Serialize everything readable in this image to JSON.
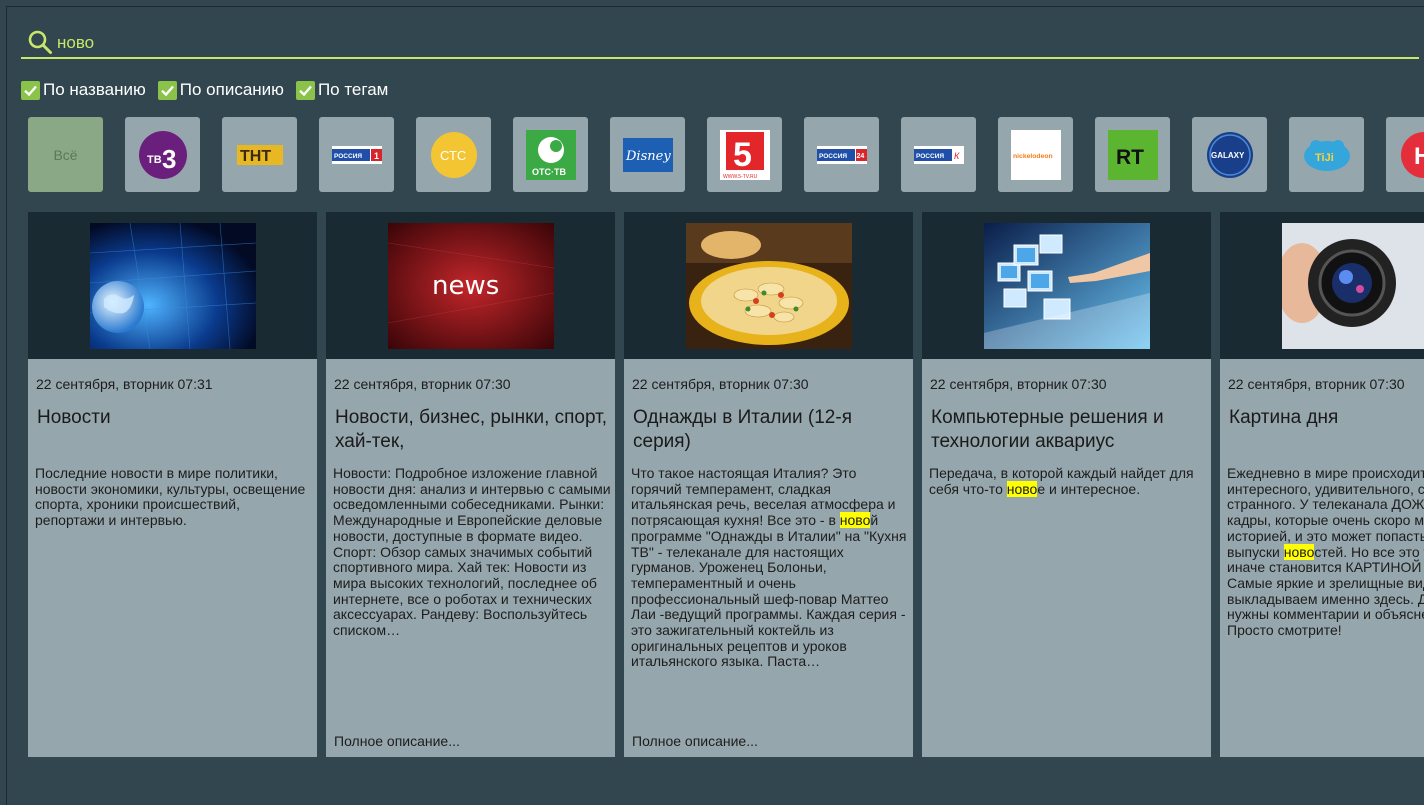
{
  "search": {
    "value": "ново",
    "accent": "#c8e76a"
  },
  "filters": [
    {
      "label": "По названию",
      "checked": true
    },
    {
      "label": "По описанию",
      "checked": true
    },
    {
      "label": "По тегам",
      "checked": true
    }
  ],
  "channels": {
    "all_label": "Всё",
    "items": [
      {
        "name": "тв3-logo",
        "text": "ТВ3"
      },
      {
        "name": "tnt-logo",
        "text": "ТНТ"
      },
      {
        "name": "russia1-logo",
        "text": "РОССИЯ 1"
      },
      {
        "name": "sts-logo",
        "text": "СТС"
      },
      {
        "name": "otstv-logo",
        "text": "ОТС-ТВ"
      },
      {
        "name": "disney-logo",
        "text": "Disney"
      },
      {
        "name": "channel5-logo",
        "text": "5"
      },
      {
        "name": "russia24-logo",
        "text": "РОССИЯ 24"
      },
      {
        "name": "russiak-logo",
        "text": "РОССИЯ К"
      },
      {
        "name": "nickelodeon-logo",
        "text": "nickelodeon"
      },
      {
        "name": "rt-logo",
        "text": "RT"
      },
      {
        "name": "galaxy-logo",
        "text": "GALAXY"
      },
      {
        "name": "tiji-logo",
        "text": "TiJi"
      },
      {
        "name": "partial-logo",
        "text": "Н"
      }
    ]
  },
  "cards": [
    {
      "date": "22 сентября, вторник 07:31",
      "title": "Новости",
      "desc": [
        "Последние новости в мире политики, новости экономики, культуры, освещение спорта, хроники происшествий, репортажи и интервью."
      ],
      "more": ""
    },
    {
      "date": "22 сентября, вторник 07:30",
      "title": "Новости, бизнес, рынки, спорт, хай-тек,",
      "desc": [
        "Новости: Подробное изложение главной новости дня: анализ и интервью с самыми осведомленными собеседниками. Рынки: Международные и Европейские деловые новости, доступные в формате видео. Спорт: Обзор самых значимых событий спортивного мира. Хай тек: Новости из мира высоких технологий, последнее об интернете, все о роботах и технических аксессуарах. Рандеву: Воспользуйтесь списком…"
      ],
      "more": "Полное описание..."
    },
    {
      "date": "22 сентября, вторник 07:30",
      "title": "Однажды в Италии (12-я серия)",
      "desc": [
        "Что такое настоящая Италия? Это горячий темперамент, сладкая итальянская речь, веселая атмосфера и потрясающая кухня! Все это - в ",
        "ново",
        "й программе \"Однажды в Италии\" на \"Кухня ТВ\" - телеканале для настоящих гурманов. Уроженец Болоньи, темпераментный и очень профессиональный шеф-повар  Маттео Лаи -ведущий программы. Каждая серия - это зажигательный коктейль из оригинальных рецептов и уроков итальянского языка. Паста…"
      ],
      "more": "Полное описание..."
    },
    {
      "date": "22 сентября, вторник 07:30",
      "title": "Компьютерные решения и технологии аквариус",
      "desc": [
        "Передача, в которой каждый найдет для себя что-то ",
        "ново",
        "е и интересное."
      ],
      "more": ""
    },
    {
      "date": "22 сентября, вторник 07:30",
      "title": "Картина дня",
      "desc": [
        "Ежедневно в мире происходит много интересного, удивительного, страшного и странного. У телеканала ДОЖДЬ есть кадры, которые очень скоро могут стать историей, и это может попасть в наши выпуски ",
        "ново",
        "стей. Но все это так или иначе становится КАРТИНОЙ ДНЯ. Самые яркие и зрелищные видео дня мы выкладываем именно здесь. Для них не нужны комментарии и объяснения. Просто смотрите!"
      ],
      "more": ""
    }
  ]
}
